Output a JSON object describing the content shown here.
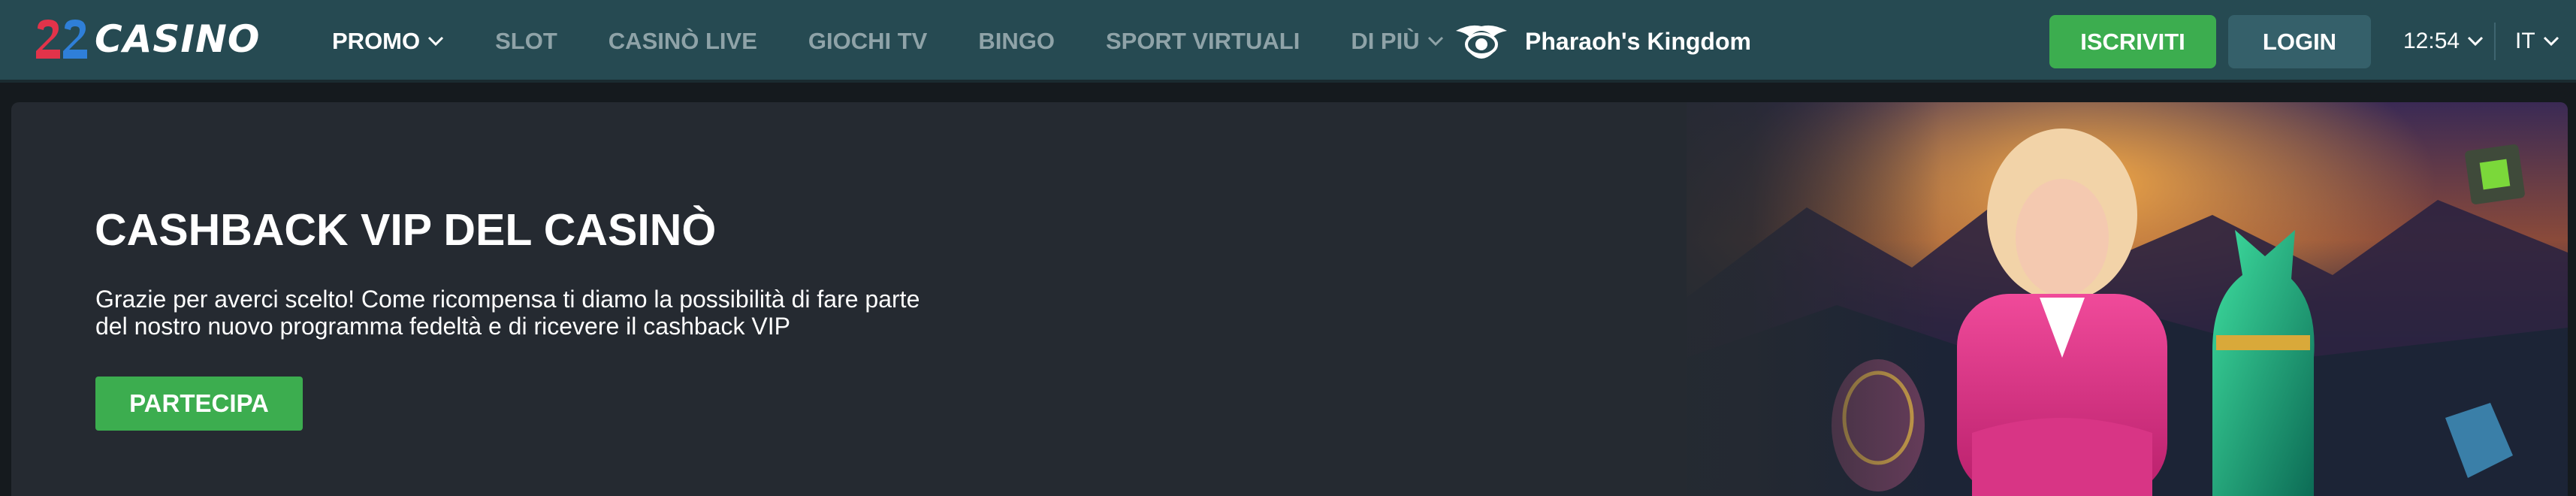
{
  "header": {
    "logo_text": "CASINO",
    "logo_number": "22",
    "nav": [
      {
        "label": "PROMO",
        "has_dropdown": true,
        "active": true
      },
      {
        "label": "SLOT",
        "has_dropdown": false,
        "active": false
      },
      {
        "label": "CASINÒ LIVE",
        "has_dropdown": false,
        "active": false
      },
      {
        "label": "GIOCHI TV",
        "has_dropdown": false,
        "active": false
      },
      {
        "label": "BINGO",
        "has_dropdown": false,
        "active": false
      },
      {
        "label": "SPORT VIRTUALI",
        "has_dropdown": false,
        "active": false
      },
      {
        "label": "DI PIÙ",
        "has_dropdown": true,
        "active": false
      }
    ],
    "featured_game": {
      "label": "Pharaoh's Kingdom",
      "icon": "pharaoh-eye-icon"
    },
    "register_label": "ISCRIVITI",
    "login_label": "LOGIN",
    "time": "12:54",
    "language": "IT"
  },
  "banner": {
    "title": "CASHBACK VIP DEL CASINÒ",
    "description": "Grazie per averci scelto! Come ricompensa ti diamo la possibilità di fare parte del nostro nuovo programma fedeltà e di ricevere il cashback VIP",
    "cta_label": "PARTECIPA"
  },
  "colors": {
    "header_bg": "#264a52",
    "accent_green": "#3cad4f",
    "login_bg": "#35606a",
    "banner_bg": "#252a31",
    "page_bg": "#151a1e",
    "nav_inactive": "#8fa3a8"
  }
}
